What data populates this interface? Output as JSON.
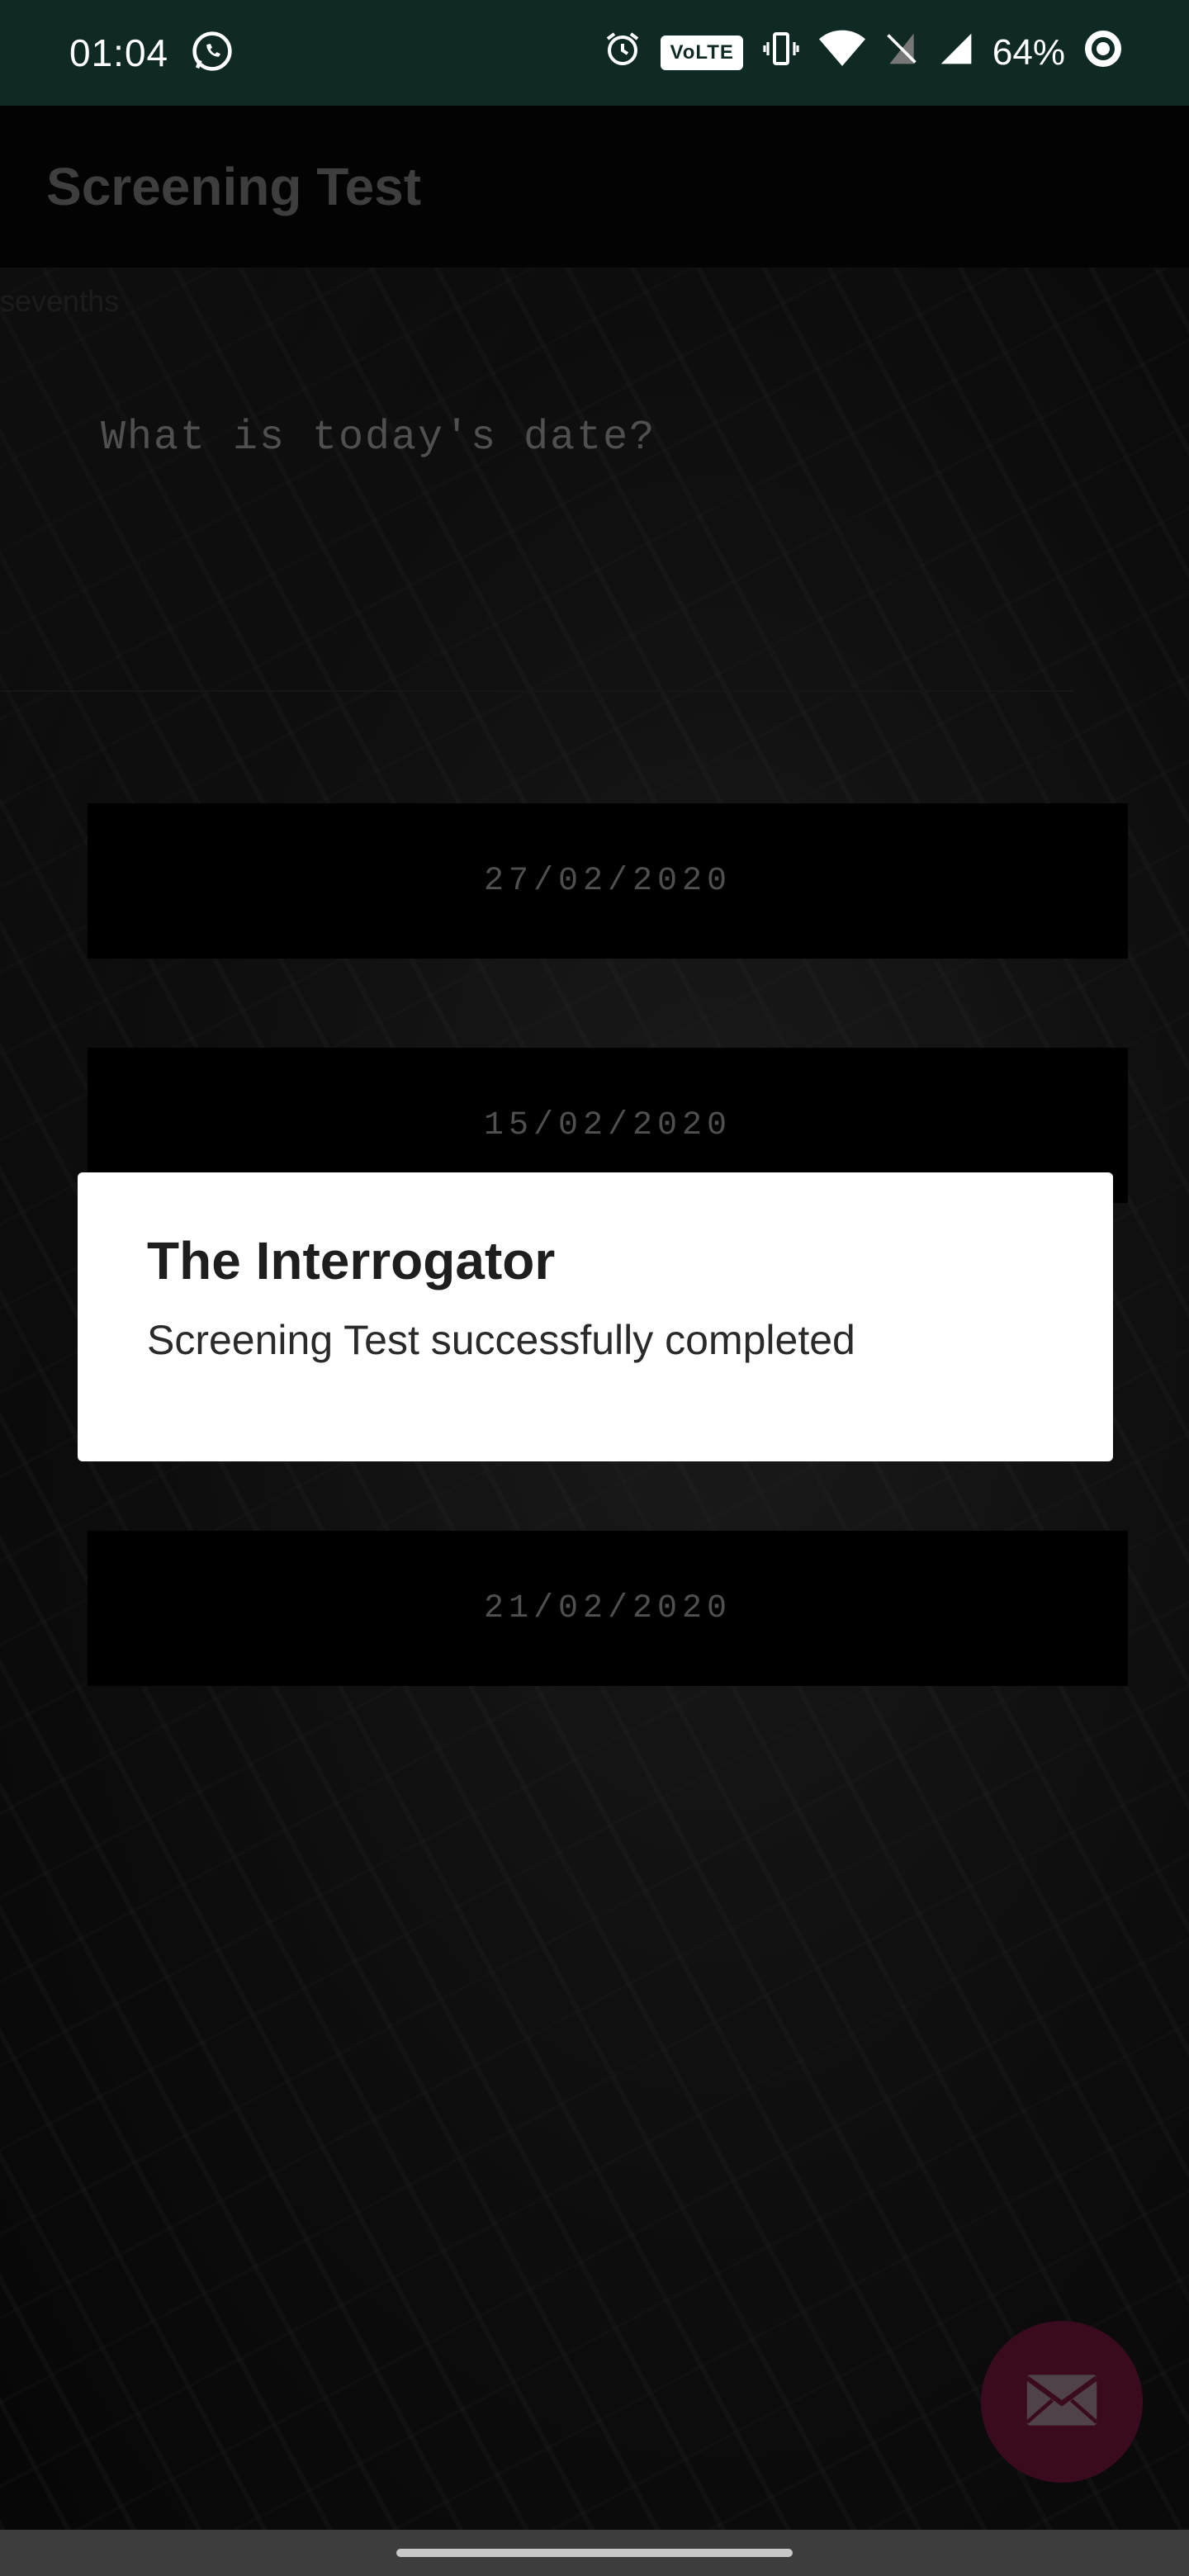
{
  "status_bar": {
    "time": "01:04",
    "battery": "64%",
    "volte": "VoLTE",
    "icons": [
      "whatsapp-icon",
      "alarm-icon",
      "volte-icon",
      "vibrate-icon",
      "wifi-icon",
      "no-sim-icon",
      "signal-icon",
      "battery-icon"
    ]
  },
  "toolbar": {
    "title": "Screening Test"
  },
  "content": {
    "residual_text": "sevenths",
    "question": "What is today's date?",
    "answers": [
      "27/02/2020",
      "15/02/2020",
      "21/02/2020"
    ],
    "fab_icon": "mail-icon"
  },
  "dialog": {
    "title": "The Interrogator",
    "message": "Screening Test successfully completed"
  },
  "colors": {
    "status_bar": "#0f2a24",
    "fab": "#5a1230",
    "dialog_bg": "#ffffff"
  }
}
